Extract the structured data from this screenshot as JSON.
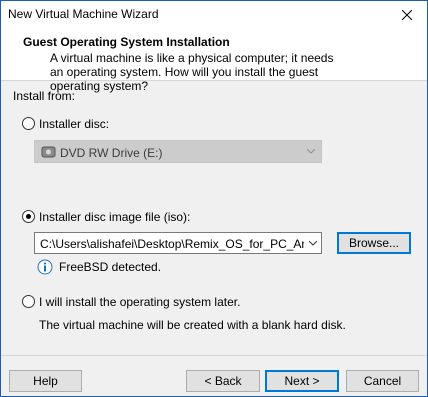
{
  "window": {
    "title": "New Virtual Machine Wizard"
  },
  "header": {
    "title": "Guest Operating System Installation",
    "description": "A virtual machine is like a physical computer; it needs an operating system. How will you install the guest operating system?"
  },
  "install_from": {
    "label": "Install from:",
    "installer_disc": {
      "label": "Installer disc:",
      "selected": false,
      "drive_value": "DVD RW Drive (E:)",
      "enabled": false
    },
    "iso": {
      "label": "Installer disc image file (iso):",
      "selected": true,
      "path_value": "C:\\Users\\alishafei\\Desktop\\Remix_OS_for_PC_Android",
      "browse_label": "Browse...",
      "detected_message": "FreeBSD detected."
    },
    "later": {
      "label": "I will install the operating system later.",
      "selected": false,
      "description": "The virtual machine will be created with a blank hard disk."
    }
  },
  "footer": {
    "help_label": "Help",
    "back_label": "< Back",
    "next_label": "Next >",
    "cancel_label": "Cancel"
  }
}
